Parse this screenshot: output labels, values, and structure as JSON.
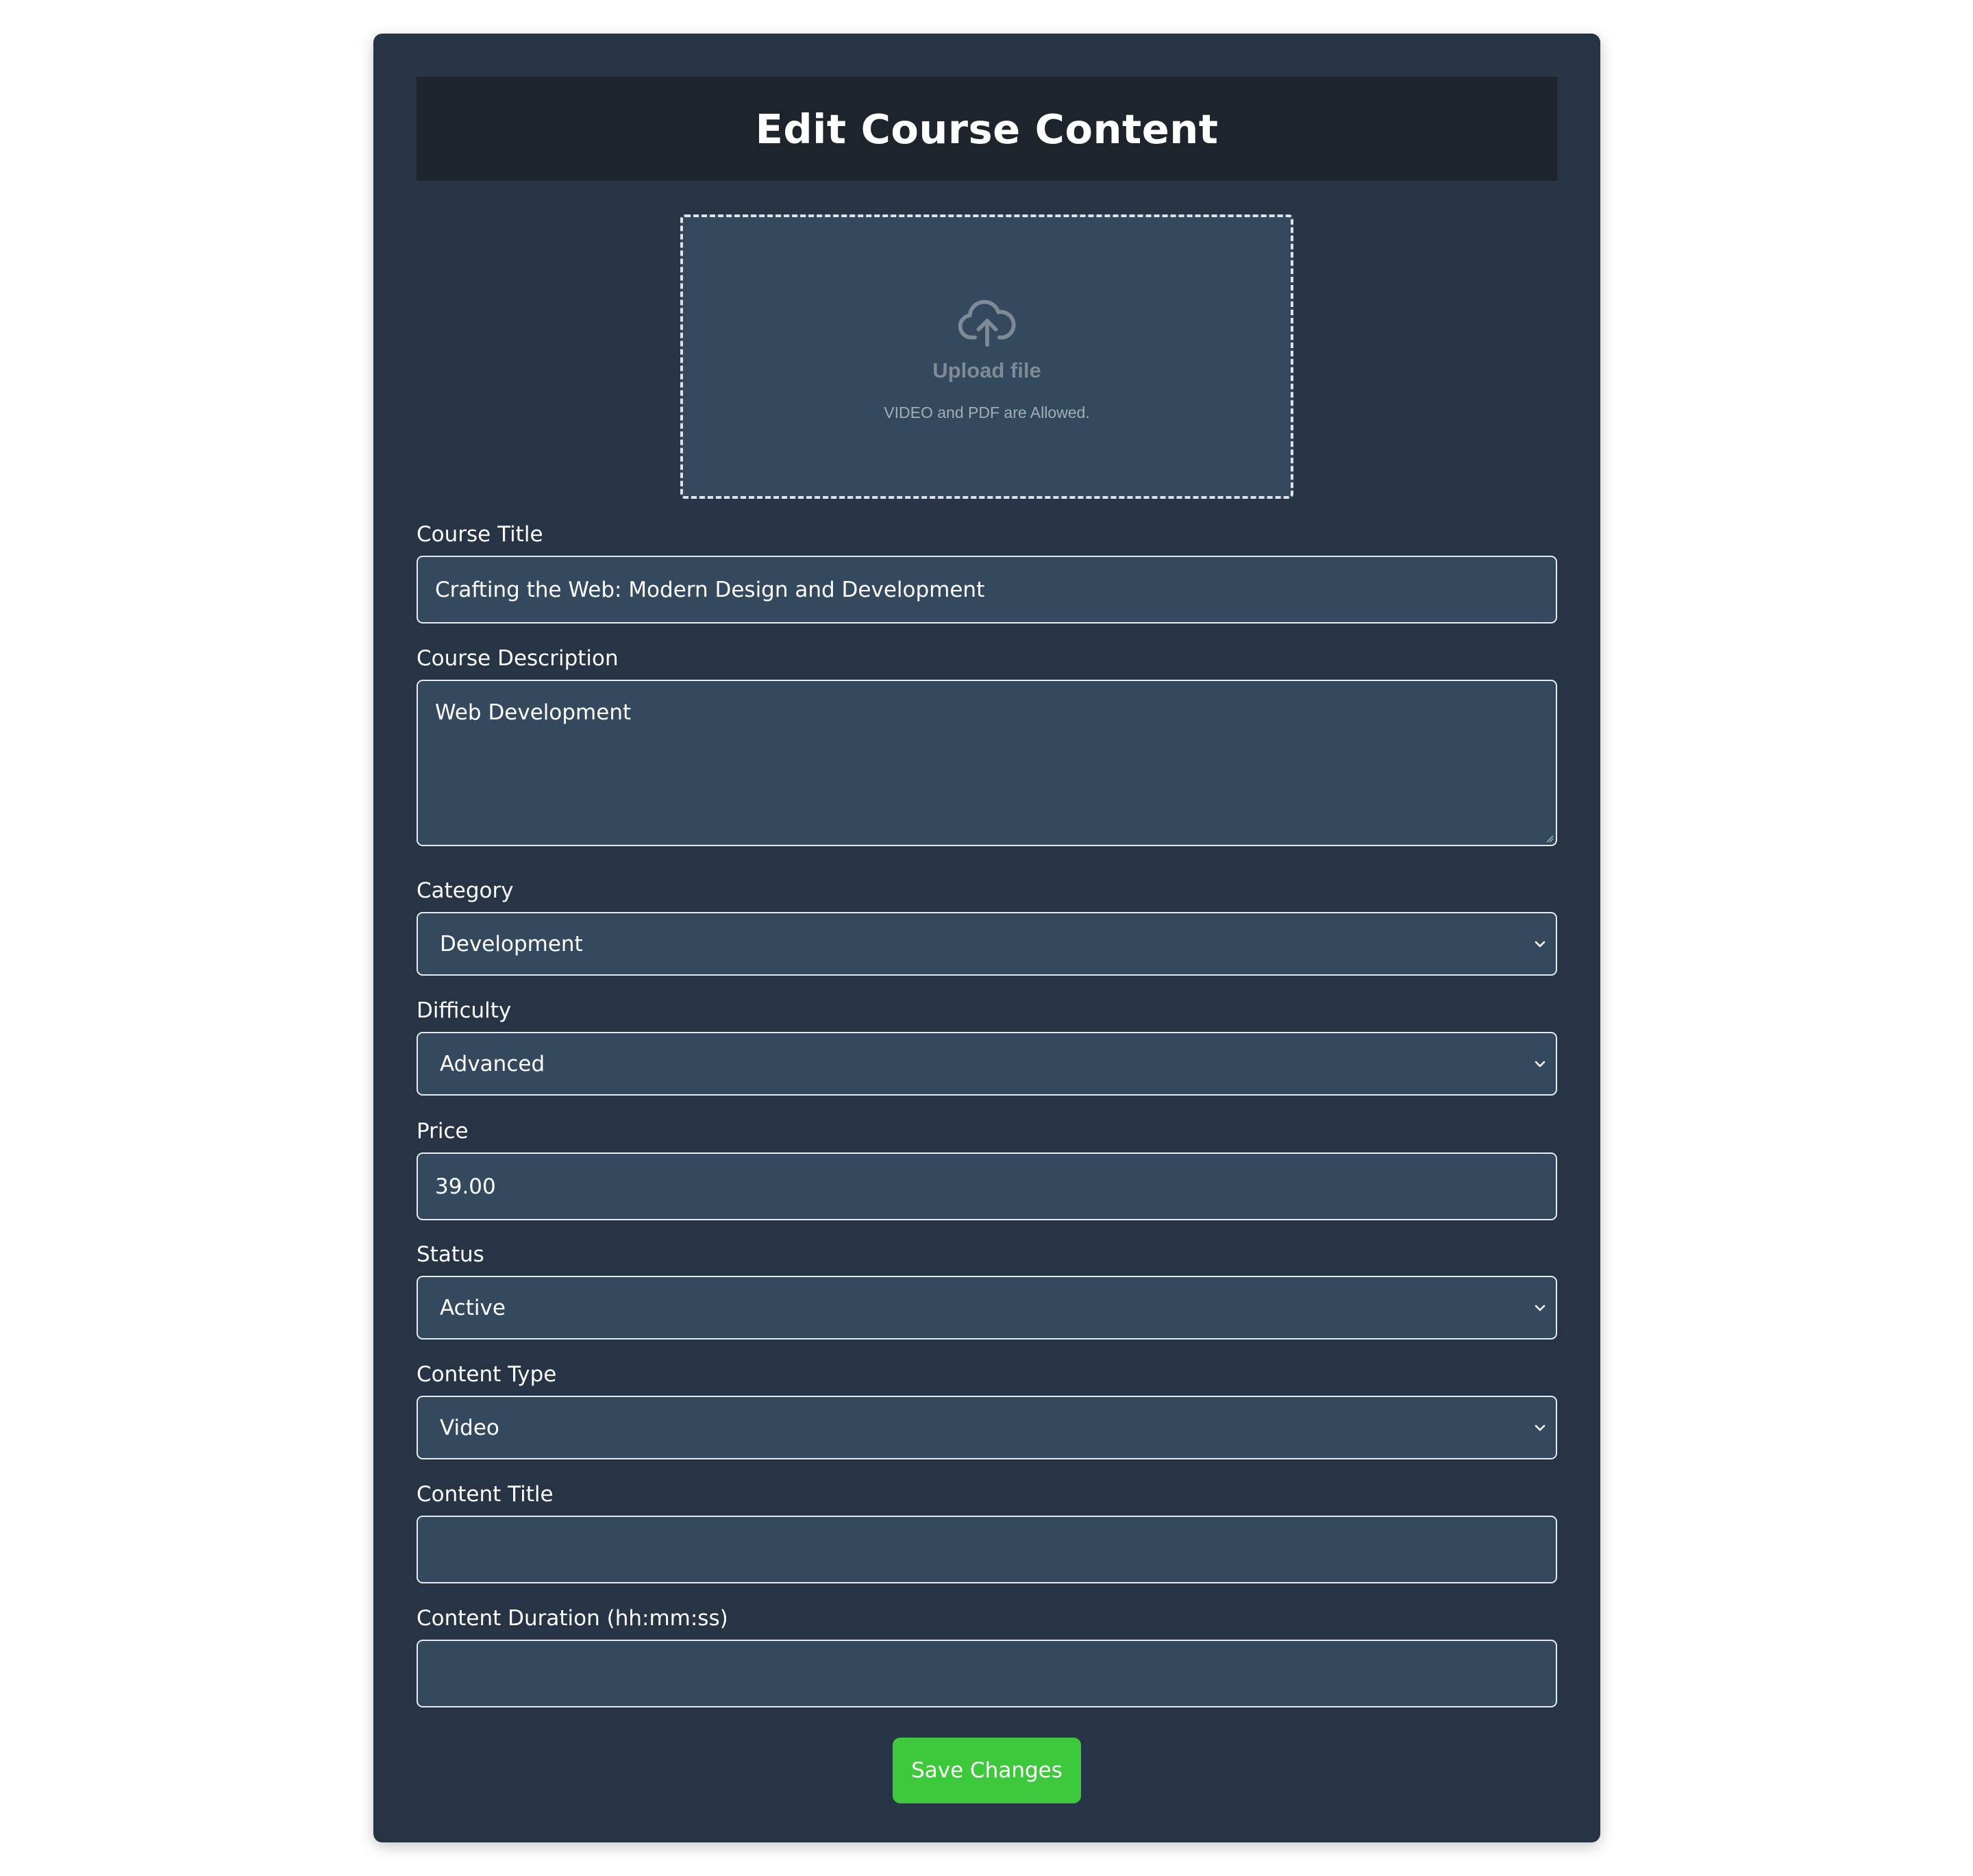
{
  "header": {
    "title": "Edit Course Content"
  },
  "upload": {
    "icon": "cloud-upload-icon",
    "title": "Upload file",
    "subtitle": "VIDEO and PDF are Allowed."
  },
  "form": {
    "course_title": {
      "label": "Course Title",
      "value": "Crafting the Web: Modern Design and Development"
    },
    "course_description": {
      "label": "Course Description",
      "value": "Web Development"
    },
    "category": {
      "label": "Category",
      "value": "Development"
    },
    "difficulty": {
      "label": "Difficulty",
      "value": "Advanced"
    },
    "price": {
      "label": "Price",
      "value": "39.00"
    },
    "status": {
      "label": "Status",
      "value": "Active"
    },
    "content_type": {
      "label": "Content Type",
      "value": "Video"
    },
    "content_title": {
      "label": "Content Title",
      "value": ""
    },
    "content_duration": {
      "label": "Content Duration (hh:mm:ss)",
      "value": ""
    }
  },
  "actions": {
    "save_label": "Save Changes"
  },
  "colors": {
    "card_bg": "#263445",
    "header_bg": "#1e242c",
    "field_bg": "#34495e",
    "save_button": "#3ec83c"
  }
}
